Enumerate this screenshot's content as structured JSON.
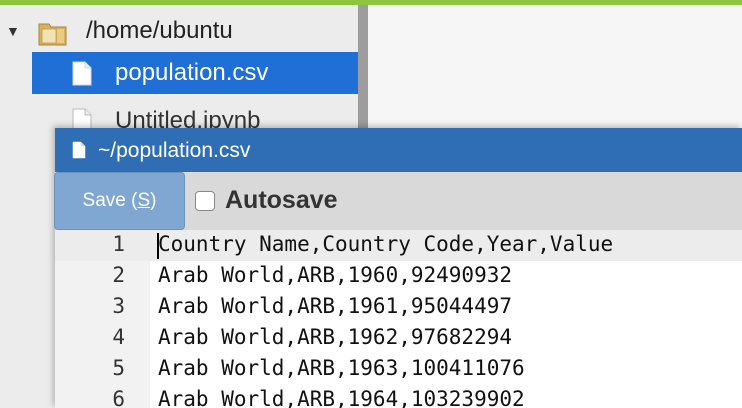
{
  "file_tree": {
    "root": {
      "label": "/home/ubuntu",
      "icon": "folder-icon"
    },
    "items": [
      {
        "label": "population.csv",
        "icon": "file-icon",
        "selected": true
      },
      {
        "label": "Untitled.ipynb",
        "icon": "file-icon",
        "selected": false
      }
    ]
  },
  "editor": {
    "title": "~/population.csv",
    "save_label": "Save (",
    "save_key": "S",
    "save_suffix": ")",
    "autosave_label": "Autosave",
    "autosave_checked": false,
    "lines": [
      {
        "num": "1",
        "text": "Country Name,Country Code,Year,Value"
      },
      {
        "num": "2",
        "text": "Arab World,ARB,1960,92490932"
      },
      {
        "num": "3",
        "text": "Arab World,ARB,1961,95044497"
      },
      {
        "num": "4",
        "text": "Arab World,ARB,1962,97682294"
      },
      {
        "num": "5",
        "text": "Arab World,ARB,1963,100411076"
      },
      {
        "num": "6",
        "text": "Arab World,ARB,1964,103239902"
      }
    ]
  },
  "colors": {
    "accent": "#8cc63f",
    "selection": "#1f6fd6",
    "dialog_title": "#2f6eb5",
    "save_button": "#7fa7d1"
  }
}
